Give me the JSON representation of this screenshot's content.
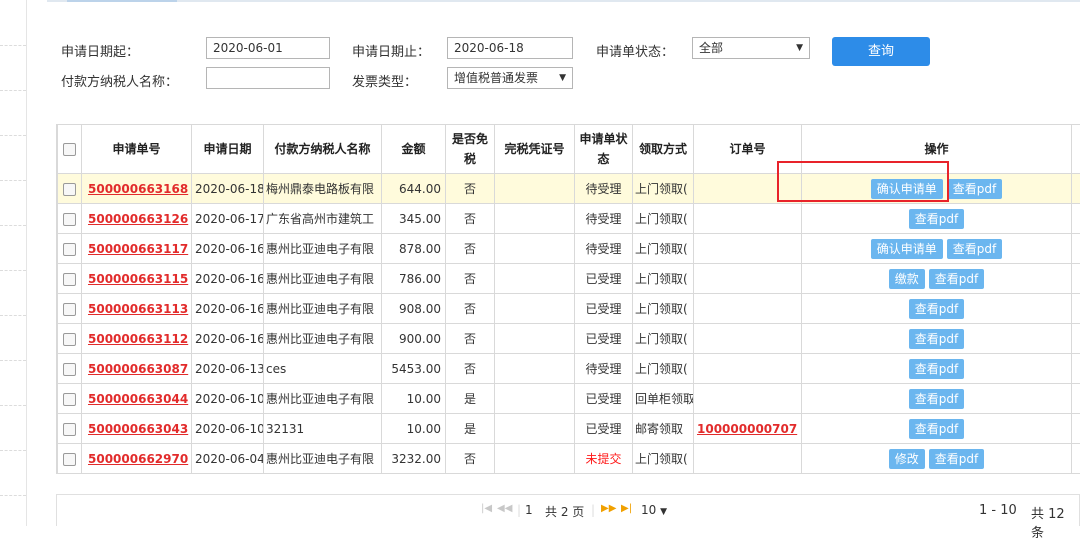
{
  "filters": {
    "date_from_label": "申请日期起：",
    "date_from_value": "2020-06-01",
    "date_to_label": "申请日期止：",
    "date_to_value": "2020-06-18",
    "status_label": "申请单状态：",
    "status_value": "全部",
    "payer_label": "付款方纳税人名称：",
    "payer_value": "",
    "invoice_type_label": "发票类型：",
    "invoice_type_value": "增值税普通发票",
    "query_button": "查询"
  },
  "table": {
    "headers": {
      "apply_no": "申请单号",
      "apply_date": "申请日期",
      "payer": "付款方纳税人名称",
      "amount": "金额",
      "tax_free_1": "是否免",
      "tax_free_2": "税",
      "tax_voucher": "完税凭证号",
      "status_1": "申请单状",
      "status_2": "态",
      "pickup": "领取方式",
      "order_no": "订单号",
      "ops": "操作"
    },
    "rows": [
      {
        "no": "500000663168",
        "date": "2020-06-18",
        "payer": "梅州鼎泰电路板有限",
        "amount": "644.00",
        "free": "否",
        "voucher": "",
        "status": "待受理",
        "pickup": "上门领取(",
        "order": "",
        "ops": [
          "确认申请单",
          "查看pdf"
        ],
        "highlight": true
      },
      {
        "no": "500000663126",
        "date": "2020-06-17",
        "payer": "广东省高州市建筑工",
        "amount": "345.00",
        "free": "否",
        "voucher": "",
        "status": "待受理",
        "pickup": "上门领取(",
        "order": "",
        "ops": [
          "查看pdf"
        ]
      },
      {
        "no": "500000663117",
        "date": "2020-06-16",
        "payer": "惠州比亚迪电子有限",
        "amount": "878.00",
        "free": "否",
        "voucher": "",
        "status": "待受理",
        "pickup": "上门领取(",
        "order": "",
        "ops": [
          "确认申请单",
          "查看pdf"
        ]
      },
      {
        "no": "500000663115",
        "date": "2020-06-16",
        "payer": "惠州比亚迪电子有限",
        "amount": "786.00",
        "free": "否",
        "voucher": "",
        "status": "已受理",
        "pickup": "上门领取(",
        "order": "",
        "ops": [
          "缴款",
          "查看pdf"
        ]
      },
      {
        "no": "500000663113",
        "date": "2020-06-16",
        "payer": "惠州比亚迪电子有限",
        "amount": "908.00",
        "free": "否",
        "voucher": "",
        "status": "已受理",
        "pickup": "上门领取(",
        "order": "",
        "ops": [
          "查看pdf"
        ]
      },
      {
        "no": "500000663112",
        "date": "2020-06-16",
        "payer": "惠州比亚迪电子有限",
        "amount": "900.00",
        "free": "否",
        "voucher": "",
        "status": "已受理",
        "pickup": "上门领取(",
        "order": "",
        "ops": [
          "查看pdf"
        ]
      },
      {
        "no": "500000663087",
        "date": "2020-06-13",
        "payer": "ces",
        "amount": "5453.00",
        "free": "否",
        "voucher": "",
        "status": "待受理",
        "pickup": "上门领取(",
        "order": "",
        "ops": [
          "查看pdf"
        ]
      },
      {
        "no": "500000663044",
        "date": "2020-06-10",
        "payer": "惠州比亚迪电子有限",
        "amount": "10.00",
        "free": "是",
        "voucher": "",
        "status": "已受理",
        "pickup": "回单柜领取",
        "order": "",
        "ops": [
          "查看pdf"
        ]
      },
      {
        "no": "500000663043",
        "date": "2020-06-10",
        "payer": "32131",
        "amount": "10.00",
        "free": "是",
        "voucher": "",
        "status": "已受理",
        "pickup": "邮寄领取",
        "order": "100000000707",
        "ops": [
          "查看pdf"
        ]
      },
      {
        "no": "500000662970",
        "date": "2020-06-04",
        "payer": "惠州比亚迪电子有限",
        "amount": "3232.00",
        "free": "否",
        "voucher": "",
        "status": "未提交",
        "status_red": true,
        "pickup": "上门领取(",
        "order": "",
        "ops": [
          "修改",
          "查看pdf"
        ]
      }
    ]
  },
  "pager": {
    "current_page": "1",
    "total_pages_text": "共 2 页",
    "page_size": "10",
    "range_text": "1 - 10",
    "total_text": "共 12 条"
  },
  "colors": {
    "link_red": "#e22b2b",
    "query_blue": "#2d8ce8",
    "op_blue": "#6bb6ef",
    "highlight_row": "#fffbdc",
    "annotation_red": "#e8232a"
  }
}
